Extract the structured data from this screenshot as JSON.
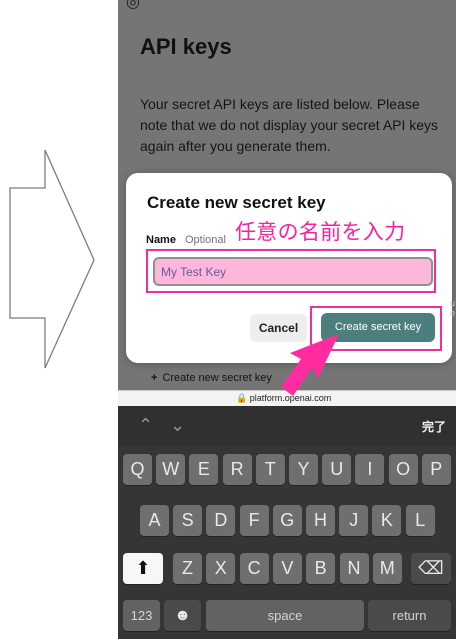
{
  "page": {
    "title": "API keys",
    "description": "Your secret API keys are listed below. Please note that we do not display your secret API keys again after you generate them."
  },
  "dialog": {
    "title": "Create new secret key",
    "name_label": "Name",
    "optional_label": "Optional",
    "annotation": "任意の名前を入力",
    "input_placeholder": "My Test Key",
    "cancel_label": "Cancel",
    "create_label": "Create secret key"
  },
  "list": {
    "new_key_label": "Create new secret key"
  },
  "browser": {
    "url": "platform.openai.com"
  },
  "keyboard": {
    "done_label": "完了",
    "row1": [
      "Q",
      "W",
      "E",
      "R",
      "T",
      "Y",
      "U",
      "I",
      "O",
      "P"
    ],
    "row2": [
      "A",
      "S",
      "D",
      "F",
      "G",
      "H",
      "J",
      "K",
      "L"
    ],
    "row3": [
      "Z",
      "X",
      "C",
      "V",
      "B",
      "N",
      "M"
    ],
    "numbers_label": "123",
    "space_label": "space",
    "return_label": "return"
  },
  "icons": {
    "logo_fragment": "logo-icon",
    "lock": "lock-icon",
    "up": "chevron-up-icon",
    "down": "chevron-down-icon",
    "shift": "shift-icon",
    "delete": "delete-icon",
    "emoji": "emoji-icon",
    "plus": "plus-icon"
  },
  "colors": {
    "accent_pink": "#ef2f9c",
    "button_teal": "#4b7f7d",
    "input_fill": "#ffb6da"
  }
}
